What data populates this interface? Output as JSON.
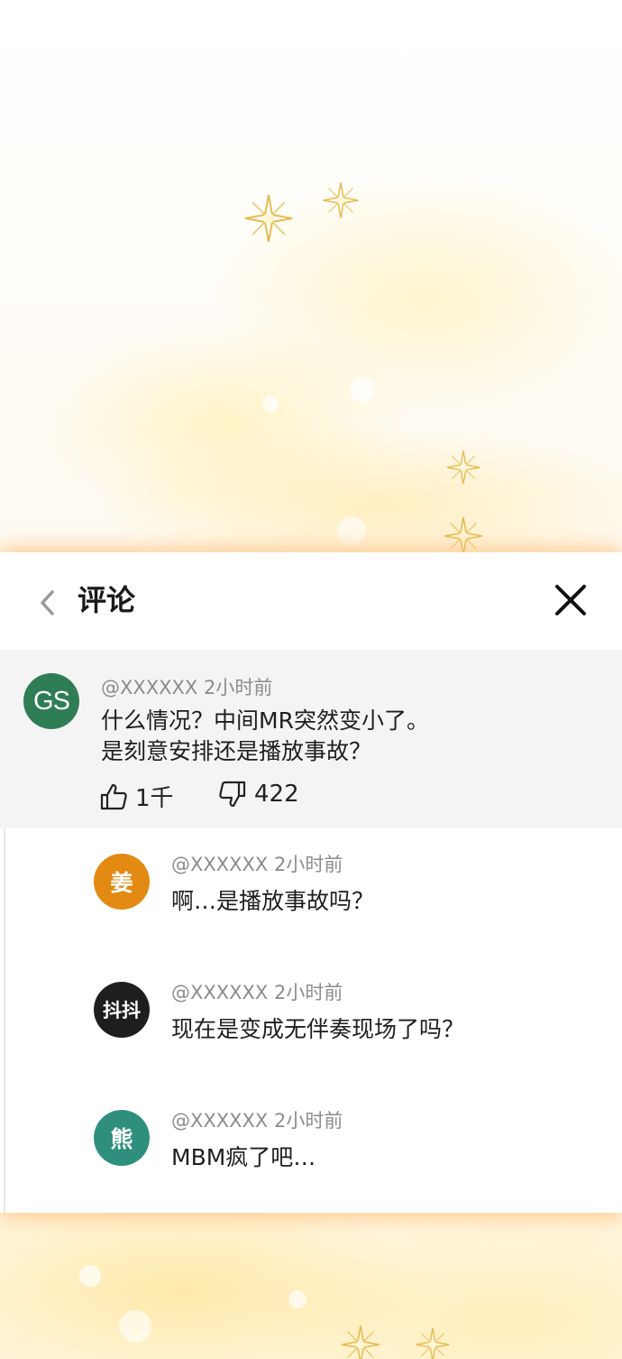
{
  "header": {
    "title": "评论",
    "back_icon": "chevron-left-icon",
    "close_icon": "close-icon"
  },
  "main_comment": {
    "avatar_text": "GS",
    "avatar_color": "#2f7d55",
    "username": "@XXXXXX",
    "time": "2小时前",
    "text_line1": "什么情况？中间MR突然变小了。",
    "text_line2": "是刻意安排还是播放事故？",
    "likes": "1千",
    "dislikes": "422"
  },
  "replies": [
    {
      "avatar_text": "姜",
      "avatar_color": "#e38a12",
      "username": "@XXXXXX",
      "time": "2小时前",
      "text": "啊…是播放事故吗？"
    },
    {
      "avatar_text": "抖抖",
      "avatar_color": "#1e1e1e",
      "username": "@XXXXXX",
      "time": "2小时前",
      "text": "现在是变成无伴奏现场了吗？"
    },
    {
      "avatar_text": "熊",
      "avatar_color": "#2e8f7d",
      "username": "@XXXXXX",
      "time": "2小时前",
      "text": "MBM疯了吧…"
    }
  ],
  "colors": {
    "panel_bg": "#ffffff",
    "main_comment_bg": "#f4f4f4",
    "meta_text": "#8c8c8c",
    "body_text": "#1e1e1e",
    "glow": "#ffc98a"
  }
}
